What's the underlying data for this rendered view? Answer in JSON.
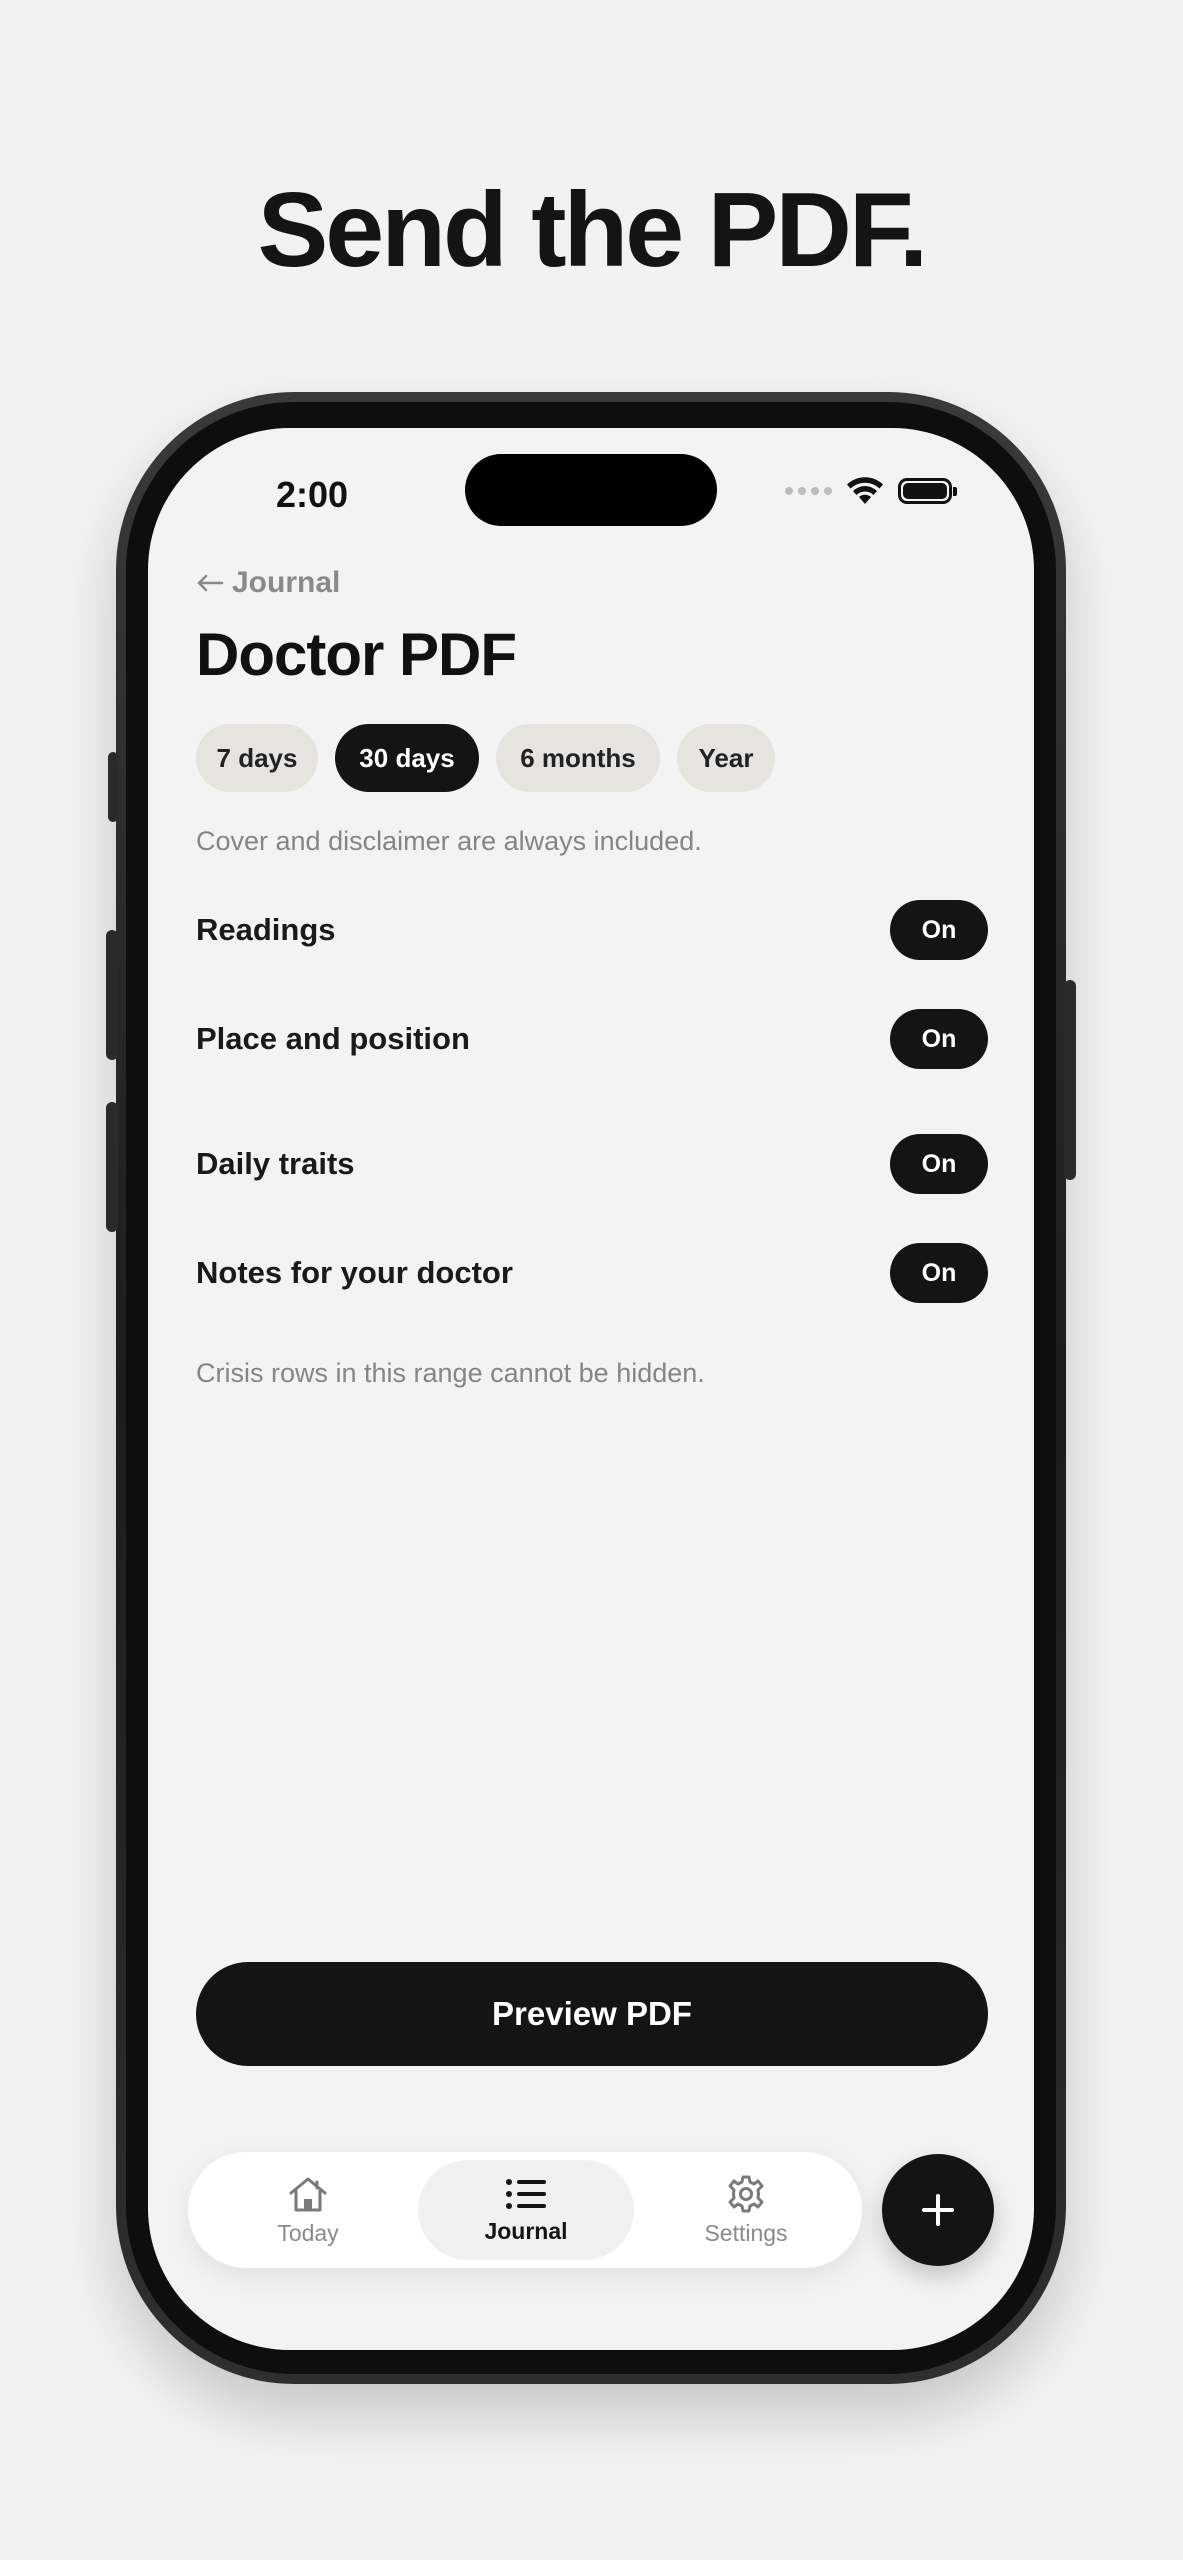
{
  "headline": "Send the PDF.",
  "status_bar": {
    "time": "2:00"
  },
  "nav": {
    "back_label": "Journal"
  },
  "page": {
    "title": "Doctor PDF"
  },
  "range_options": [
    {
      "label": "7 days",
      "selected": false
    },
    {
      "label": "30 days",
      "selected": true
    },
    {
      "label": "6 months",
      "selected": false
    },
    {
      "label": "Year",
      "selected": false
    }
  ],
  "cover_note": "Cover and disclaimer are always included.",
  "sections": [
    {
      "label": "Readings",
      "state": "On"
    },
    {
      "label": "Place and position",
      "state": "On"
    },
    {
      "label": "Daily traits",
      "state": "On"
    },
    {
      "label": "Notes for your doctor",
      "state": "On"
    }
  ],
  "crisis_note": "Crisis rows in this range cannot be hidden.",
  "preview_button": "Preview PDF",
  "tabs": [
    {
      "label": "Today",
      "icon": "home-icon",
      "active": false
    },
    {
      "label": "Journal",
      "icon": "list-icon",
      "active": true
    },
    {
      "label": "Settings",
      "icon": "gear-icon",
      "active": false
    }
  ],
  "fab_icon": "plus-icon",
  "colors": {
    "background": "#f2f2f2",
    "accent": "#141414",
    "chip_inactive": "#e6e4df",
    "muted_text": "#858585"
  }
}
